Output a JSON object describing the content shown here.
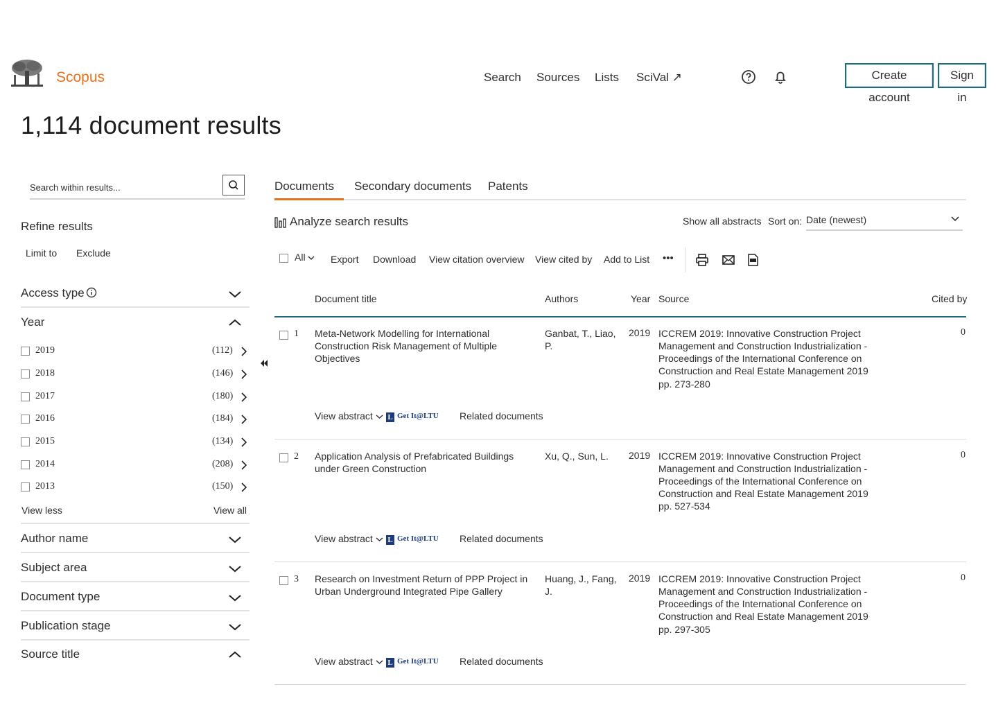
{
  "header": {
    "brand": "Scopus",
    "nav": [
      "Search",
      "Sources",
      "Lists",
      "SciVal ↗"
    ],
    "create_account": "Create account",
    "sign_in": "Sign in"
  },
  "page_title": "1,114 document results",
  "sidebar": {
    "search_placeholder": "Search within results...",
    "refine": "Refine results",
    "limit": "Limit to",
    "exclude": "Exclude",
    "facets": {
      "access_type": "Access type",
      "year": "Year",
      "author_name": "Author name",
      "subject_area": "Subject area",
      "document_type": "Document type",
      "publication_stage": "Publication stage",
      "source_title": "Source title"
    },
    "years": [
      {
        "year": "2019",
        "count": "(112)"
      },
      {
        "year": "2018",
        "count": "(146)"
      },
      {
        "year": "2017",
        "count": "(180)"
      },
      {
        "year": "2016",
        "count": "(184)"
      },
      {
        "year": "2015",
        "count": "(134)"
      },
      {
        "year": "2014",
        "count": "(208)"
      },
      {
        "year": "2013",
        "count": "(150)"
      }
    ],
    "view_less": "View less",
    "view_all": "View all"
  },
  "tabs": [
    "Documents",
    "Secondary documents",
    "Patents"
  ],
  "toolbar": {
    "analyze": "Analyze search results",
    "show_abstracts": "Show all abstracts",
    "sort_label": "Sort on:",
    "sort_value": "Date (newest)",
    "all": "All",
    "export": "Export",
    "download": "Download",
    "citation_overview": "View citation overview",
    "cited_by": "View cited by",
    "add_to_list": "Add to List",
    "more": "•••"
  },
  "columns": {
    "title": "Document title",
    "authors": "Authors",
    "year": "Year",
    "source": "Source",
    "cited_by": "Cited by"
  },
  "results": [
    {
      "num": "1",
      "title": "Meta-Network Modelling for International Construction Risk Management of Multiple Objectives",
      "authors": "Ganbat, T., Liao, P.",
      "year": "2019",
      "source": "ICCREM 2019: Innovative Construction Project Management and Construction Industrialization - Proceedings of the International Conference on Construction and Real Estate Management 2019",
      "pages": "pp. 273-280",
      "cited": "0"
    },
    {
      "num": "2",
      "title": "Application Analysis of Prefabricated Buildings under Green Construction",
      "authors": "Xu, Q., Sun, L.",
      "year": "2019",
      "source": "ICCREM 2019: Innovative Construction Project Management and Construction Industrialization - Proceedings of the International Conference on Construction and Real Estate Management 2019",
      "pages": "pp. 527-534",
      "cited": "0"
    },
    {
      "num": "3",
      "title": "Research on Investment Return of PPP Project in Urban Underground Integrated Pipe Gallery",
      "authors": "Huang, J., Fang, J.",
      "year": "2019",
      "source": "ICCREM 2019: Innovative Construction Project Management and Construction Industrialization - Proceedings of the International Conference on Construction and Real Estate Management 2019",
      "pages": "pp. 297-305",
      "cited": "0"
    }
  ],
  "row_actions": {
    "view_abstract": "View abstract",
    "get_it": "Get It@LTU",
    "related": "Related documents"
  },
  "colors": {
    "accent": "#e9711c",
    "teal": "#1f6b7a"
  },
  "icons": [
    "elsevier-tree-logo",
    "help-icon",
    "bell-icon",
    "search-icon",
    "info-icon",
    "chevron-down-icon",
    "chevron-up-icon",
    "chevron-right-icon",
    "double-chevron-left-icon",
    "bar-chart-icon",
    "print-icon",
    "email-icon",
    "pdf-icon"
  ]
}
